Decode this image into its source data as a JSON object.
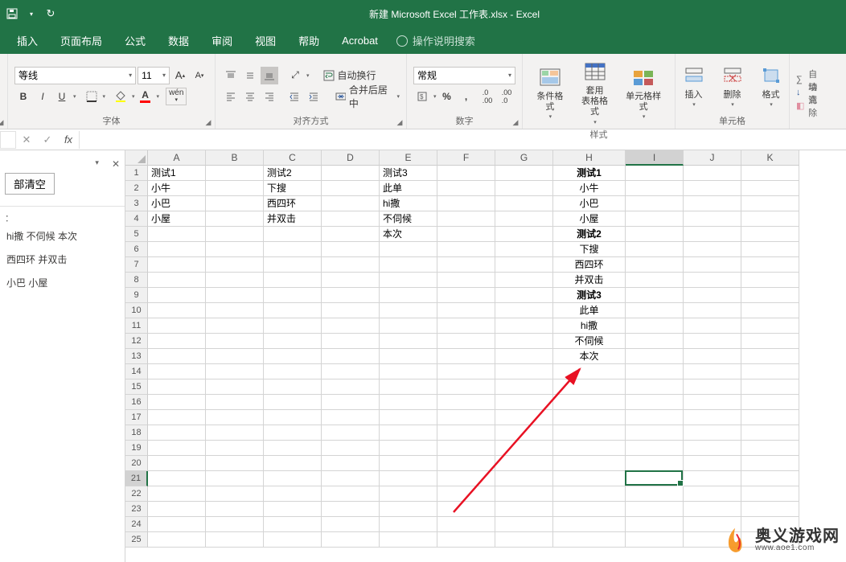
{
  "title": "新建 Microsoft Excel 工作表.xlsx  -  Excel",
  "tabs": [
    "插入",
    "页面布局",
    "公式",
    "数据",
    "审阅",
    "视图",
    "帮助",
    "Acrobat"
  ],
  "tellme": "操作说明搜索",
  "font": {
    "group": "字体",
    "name": "等线",
    "size": "11",
    "bold": "B",
    "italic": "I",
    "underline": "U",
    "phonetic": "wén"
  },
  "align": {
    "group": "对齐方式",
    "wrap": "自动换行",
    "merge": "合并后居中"
  },
  "number": {
    "group": "数字",
    "format": "常规",
    "percent": "%"
  },
  "styles": {
    "group": "样式",
    "cond": "条件格式",
    "table": "套用\n表格格式",
    "cell": "单元格样式"
  },
  "cells": {
    "group": "单元格",
    "insert": "插入",
    "delete": "删除",
    "format": "格式"
  },
  "editing": {
    "sum": "自动",
    "fill": "填充",
    "clear": "清除"
  },
  "clipboard_pane": {
    "clear": "部清空",
    "items": [
      "hi撒 不伺候 本次",
      "西四环 并双击",
      "小巴 小屋"
    ]
  },
  "cols": [
    "A",
    "B",
    "C",
    "D",
    "E",
    "F",
    "G",
    "H",
    "I",
    "J",
    "K"
  ],
  "wideH": true,
  "rows": 25,
  "cellData": {
    "A1": "测试1",
    "C1": "测试2",
    "E1": "测试3",
    "A2": "小牛",
    "C2": "下搜",
    "E2": "此单",
    "A3": "小巴",
    "C3": "西四环",
    "E3": "hi撒",
    "A4": "小屋",
    "C4": "并双击",
    "E4": "不伺候",
    "E5": "本次",
    "H1": "测试1",
    "H2": "小牛",
    "H3": "小巴",
    "H4": "小屋",
    "H5": "测试2",
    "H6": "下搜",
    "H7": "西四环",
    "H8": "并双击",
    "H9": "测试3",
    "H10": "此单",
    "H11": "hi撒",
    "H12": "不伺候",
    "H13": "本次"
  },
  "boldCells": [
    "H1",
    "H5",
    "H9"
  ],
  "centerCol": "H",
  "activeCell": {
    "col": "I",
    "row": 21
  },
  "watermark": {
    "zh": "奥义游戏网",
    "url": "www.aoe1.com"
  }
}
